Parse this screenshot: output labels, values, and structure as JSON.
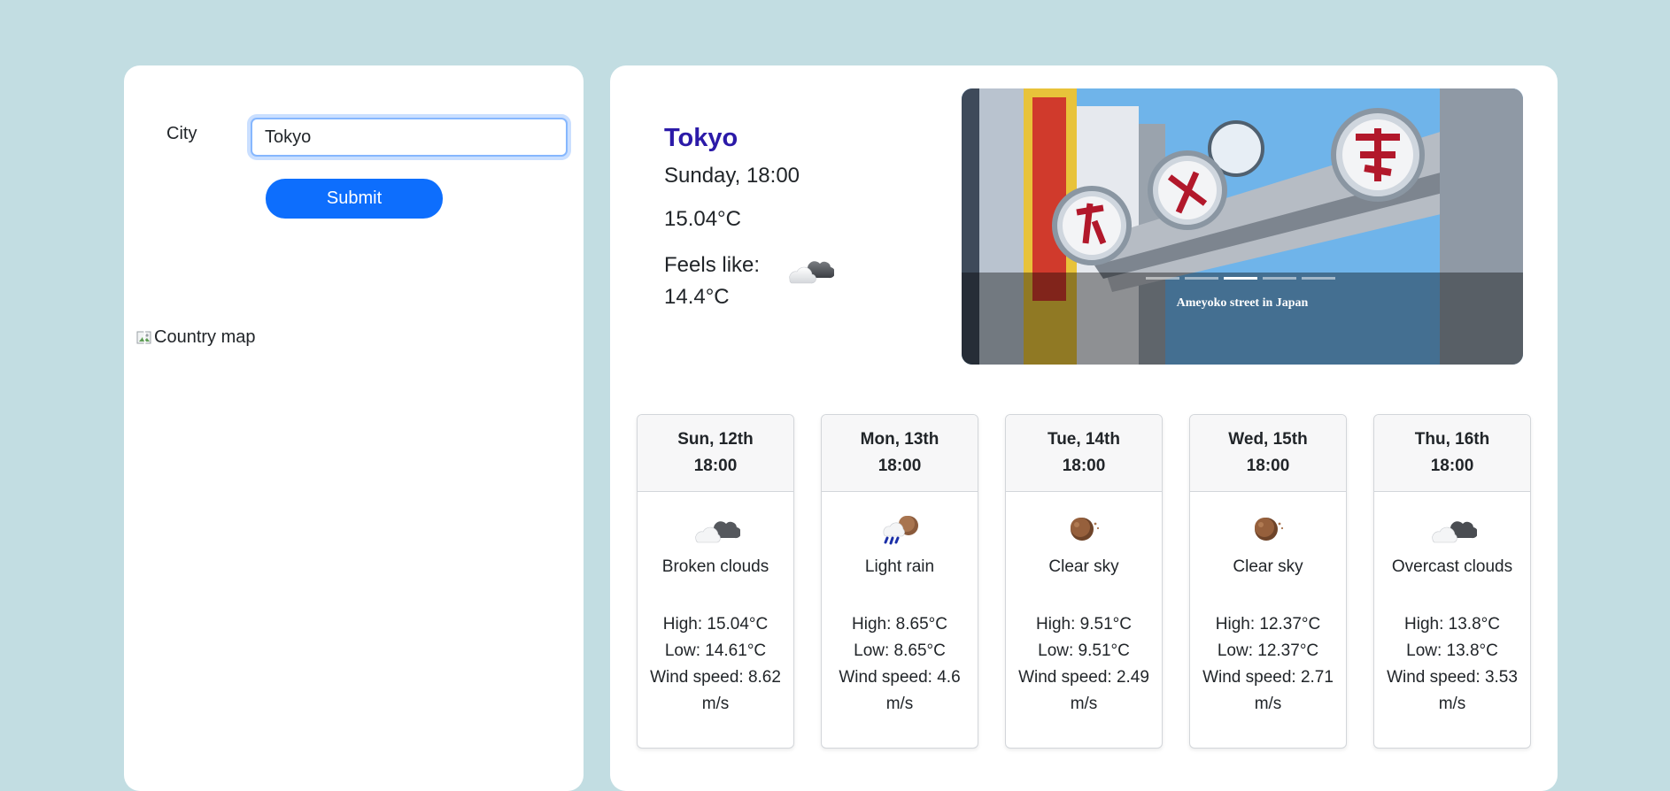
{
  "search": {
    "label": "City",
    "value": "Tokyo",
    "submit_label": "Submit"
  },
  "map": {
    "alt": "Country map"
  },
  "current": {
    "city": "Tokyo",
    "datetime": "Sunday, 18:00",
    "temp": "15.04°C",
    "feels_label": "Feels like:",
    "feels_value": "14.4°C",
    "icon": "broken-clouds-icon"
  },
  "carousel": {
    "caption": "Ameyoko street in Japan",
    "slide_count": 5,
    "active_index": 2
  },
  "forecast": [
    {
      "day": "Sun, 12th",
      "time": "18:00",
      "icon": "broken-clouds-icon",
      "desc": "Broken clouds",
      "high": "High: 15.04°C",
      "low": "Low: 14.61°C",
      "wind": "Wind speed: 8.62 m/s"
    },
    {
      "day": "Mon, 13th",
      "time": "18:00",
      "icon": "light-rain-icon",
      "desc": "Light rain",
      "high": "High: 8.65°C",
      "low": "Low: 8.65°C",
      "wind": "Wind speed: 4.6 m/s"
    },
    {
      "day": "Tue, 14th",
      "time": "18:00",
      "icon": "clear-sky-night-icon",
      "desc": "Clear sky",
      "high": "High: 9.51°C",
      "low": "Low: 9.51°C",
      "wind": "Wind speed: 2.49 m/s"
    },
    {
      "day": "Wed, 15th",
      "time": "18:00",
      "icon": "clear-sky-night-icon",
      "desc": "Clear sky",
      "high": "High: 12.37°C",
      "low": "Low: 12.37°C",
      "wind": "Wind speed: 2.71 m/s"
    },
    {
      "day": "Thu, 16th",
      "time": "18:00",
      "icon": "overcast-clouds-icon",
      "desc": "Overcast clouds",
      "high": "High: 13.8°C",
      "low": "Low: 13.8°C",
      "wind": "Wind speed: 3.53 m/s"
    }
  ],
  "colors": {
    "page_bg": "#c2dde2",
    "accent": "#0d6efd",
    "city_title": "#2b1aa8"
  }
}
